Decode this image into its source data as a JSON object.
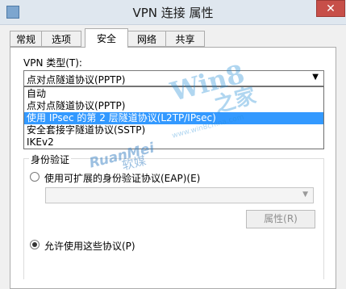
{
  "window": {
    "title": "VPN 连接 属性",
    "close_glyph": "✕"
  },
  "tabs": [
    {
      "label": "常规"
    },
    {
      "label": "选项"
    },
    {
      "label": "安全"
    },
    {
      "label": "网络"
    },
    {
      "label": "共享"
    }
  ],
  "active_tab": "安全",
  "vpn_type": {
    "label": "VPN 类型(T):",
    "selected": "点对点隧道协议(PPTP)",
    "options": [
      {
        "label": "自动"
      },
      {
        "label": "点对点隧道协议(PPTP)"
      },
      {
        "label": "使用 IPsec 的第 2 层隧道协议(L2TP/IPsec)"
      },
      {
        "label": "安全套接字隧道协议(SSTP)"
      },
      {
        "label": "IKEv2"
      }
    ],
    "highlighted_index": 2
  },
  "authentication": {
    "group_label": "身份验证",
    "eap_radio_label": "使用可扩展的身份验证协议(EAP)(E)",
    "eap_selected": false,
    "properties_button": "属性(R)",
    "allow_protocols_label": "允许使用这些协议(P)",
    "allow_selected": true
  },
  "watermarks": {
    "win8_logo": "Win8",
    "win8_logo_zh": "之家",
    "win8_url": "www.win8china.com",
    "ruanmei": "RuanMei",
    "ruanmei_zh": "软媒"
  },
  "colors": {
    "selection": "#3399ff",
    "close_button": "#c74f49",
    "titlebar": "#dfe7ef"
  }
}
